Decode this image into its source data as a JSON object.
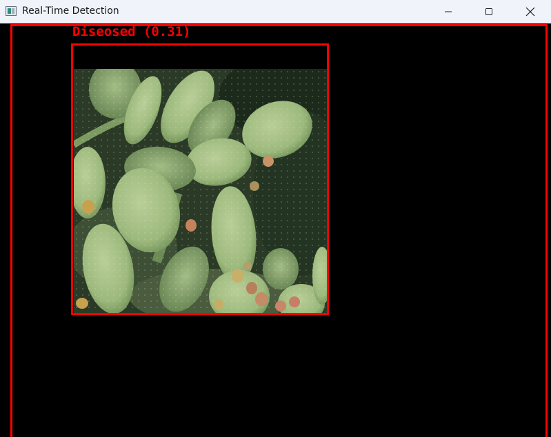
{
  "window": {
    "title": "Real-Time Detection",
    "controls": [
      "minimize",
      "maximize",
      "close"
    ]
  },
  "detection": {
    "label": "Diseosed (0.31)",
    "box_color": "#ff0000",
    "subject": "prickly pear cactus pads"
  },
  "colors": {
    "titlebar_bg": "#f0f3f9",
    "frame_bg": "#000000",
    "detection": "#ff0000"
  }
}
